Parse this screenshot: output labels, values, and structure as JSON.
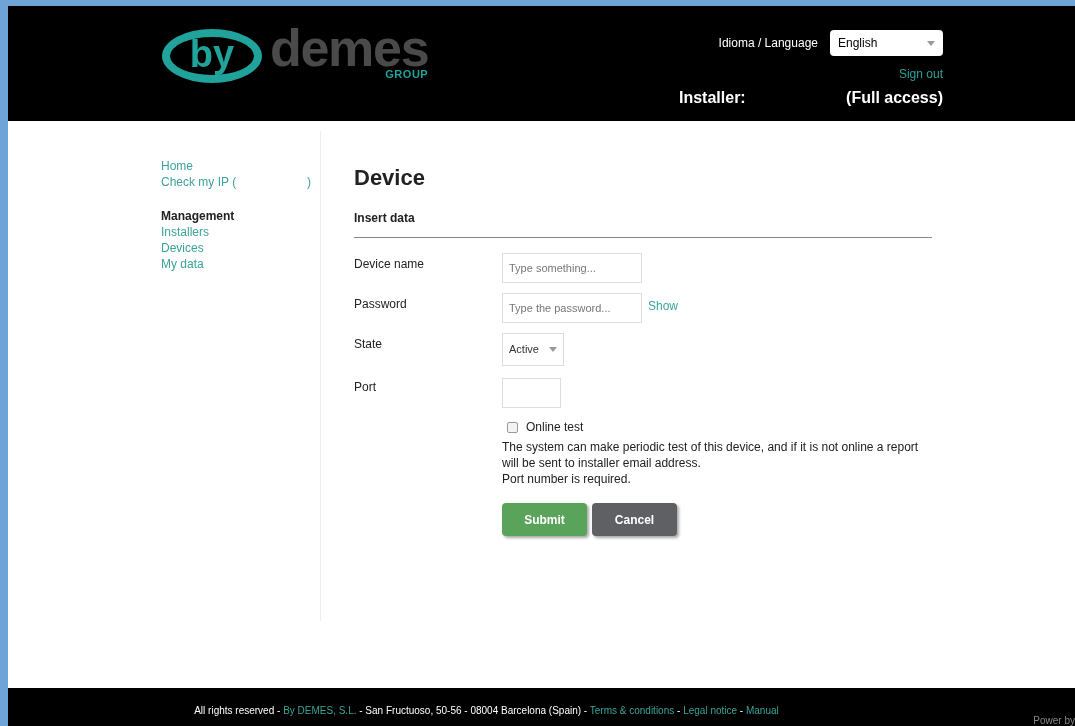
{
  "logo": {
    "mark": "by",
    "name": "demes",
    "sub": "GROUP"
  },
  "header": {
    "language_label": "Idioma / Language",
    "language_select": {
      "value": "English"
    },
    "sign_out": "Sign out",
    "user_role": "Installer:",
    "access": "(Full access)"
  },
  "sidebar": {
    "groups": [
      {
        "items": [
          {
            "label": "Home"
          },
          {
            "label": "Check my IP (",
            "suffix": ")"
          }
        ]
      },
      {
        "heading": "Management",
        "items": [
          {
            "label": "Installers"
          },
          {
            "label": "Devices"
          },
          {
            "label": "My data"
          }
        ]
      }
    ]
  },
  "form": {
    "title": "Device",
    "section": "Insert data",
    "fields": [
      {
        "kind": "text",
        "label": "Device name",
        "placeholder": "Type something..."
      },
      {
        "kind": "password",
        "label": "Password",
        "placeholder": "Type the password...",
        "link": "Show"
      },
      {
        "kind": "select",
        "label": "State",
        "value": "Active"
      },
      {
        "kind": "port",
        "label": "Port"
      }
    ],
    "checkbox": {
      "label": "Online test",
      "checked": false
    },
    "help": "The system can make periodic test of this device, and if it is not online a report will be sent to installer email address.",
    "error": "Port number is required.",
    "buttons": [
      {
        "kind": "primary",
        "label": "Submit"
      },
      {
        "kind": "secondary",
        "label": "Cancel"
      }
    ]
  },
  "footer": {
    "segments": [
      {
        "kind": "text",
        "text": "All rights reserved - "
      },
      {
        "kind": "link",
        "text": "By DEMES, S.L."
      },
      {
        "kind": "text",
        "text": " - San Fructuoso, 50-56 - 08004 Barcelona (Spain) - "
      },
      {
        "kind": "link",
        "text": "Terms & conditions"
      },
      {
        "kind": "text",
        "text": " - "
      },
      {
        "kind": "link",
        "text": "Legal notice"
      },
      {
        "kind": "text",
        "text": " - "
      },
      {
        "kind": "link",
        "text": "Manual"
      }
    ],
    "powered": "Power by"
  }
}
